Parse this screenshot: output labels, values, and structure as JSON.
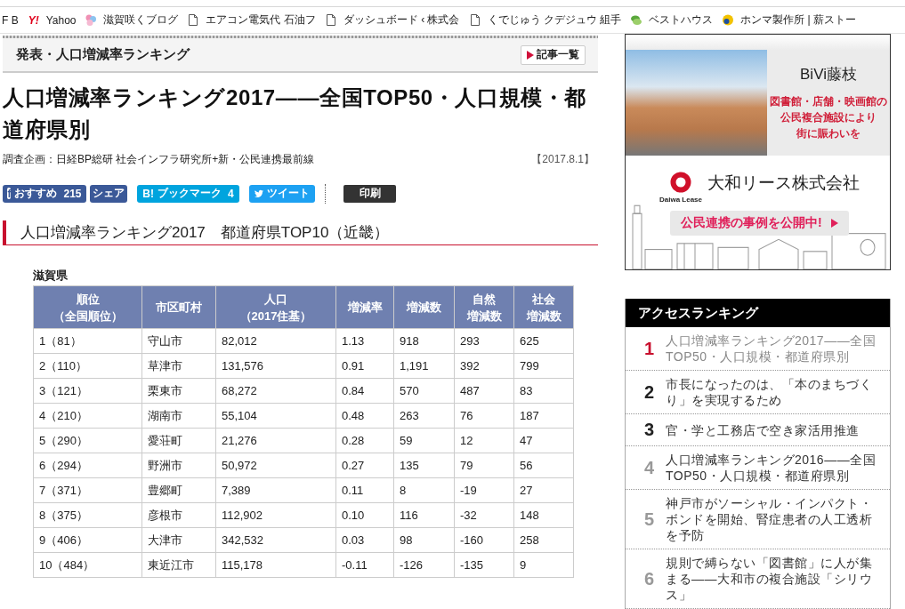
{
  "bookmarks": [
    {
      "kind": "none",
      "label": "F B"
    },
    {
      "kind": "text",
      "badge": "Y!",
      "label": "Yahoo"
    },
    {
      "kind": "flower",
      "label": "滋賀咲くブログ"
    },
    {
      "kind": "page",
      "label": "エアコン電気代 石油フ"
    },
    {
      "kind": "page",
      "label": "ダッシュボード ‹ 株式会"
    },
    {
      "kind": "page",
      "label": "くでじゅう クデジュウ 組手"
    },
    {
      "kind": "leaf",
      "label": "ベストハウス"
    },
    {
      "kind": "disc",
      "label": "ホンマ製作所 | 薪ストー"
    }
  ],
  "section_bar": {
    "title": "発表・人口増減率ランキング",
    "button": "記事一覧"
  },
  "article": {
    "title": "人口増減率ランキング2017――全国TOP50・人口規模・都道府県別",
    "byline": "調査企画：日経BP総研 社会インフラ研究所+新・公民連携最前線",
    "date": "【2017.8.1】",
    "share_buttons": [
      {
        "kind": "like",
        "badge": "f",
        "label": "おすすめ",
        "count": "215"
      },
      {
        "kind": "share",
        "label": "シェア"
      },
      {
        "kind": "bookmark",
        "badge": "B!",
        "label": "ブックマーク",
        "count": "4"
      },
      {
        "kind": "tweet",
        "label": "ツイート"
      },
      {
        "kind": "print",
        "label": "印刷"
      }
    ],
    "subheading": "人口増減率ランキング2017　都道府県TOP10（近畿）",
    "table": {
      "caption": "滋賀県",
      "columns": [
        "順位（全国順位）",
        "市区町村",
        "人口（2017住基）",
        "増減率",
        "増減数",
        "自然増減数",
        "社会増減数"
      ],
      "rows": [
        [
          "1（81）",
          "守山市",
          "82,012",
          "1.13",
          "918",
          "293",
          "625"
        ],
        [
          "2（110）",
          "草津市",
          "131,576",
          "0.91",
          "1,191",
          "392",
          "799"
        ],
        [
          "3（121）",
          "栗東市",
          "68,272",
          "0.84",
          "570",
          "487",
          "83"
        ],
        [
          "4（210）",
          "湖南市",
          "55,104",
          "0.48",
          "263",
          "76",
          "187"
        ],
        [
          "5（290）",
          "愛荘町",
          "21,276",
          "0.28",
          "59",
          "12",
          "47"
        ],
        [
          "6（294）",
          "野洲市",
          "50,972",
          "0.27",
          "135",
          "79",
          "56"
        ],
        [
          "7（371）",
          "豊郷町",
          "7,389",
          "0.11",
          "8",
          "-19",
          "27"
        ],
        [
          "8（375）",
          "彦根市",
          "112,902",
          "0.10",
          "116",
          "-32",
          "148"
        ],
        [
          "9（406）",
          "大津市",
          "342,532",
          "0.03",
          "98",
          "-160",
          "258"
        ],
        [
          "10（484）",
          "東近江市",
          "115,178",
          "-0.11",
          "-126",
          "-135",
          "9"
        ]
      ]
    }
  },
  "ad": {
    "headline": "BiVi藤枝",
    "tagline": [
      "図書館・店舗・映画館の",
      "公民複合施設により",
      "街に賑わいを"
    ],
    "logo_caption": "Daiwa Lease",
    "company": "大和リース株式会社",
    "cta": "公民連携の事例を公開中!"
  },
  "ranking": {
    "title": "アクセスランキング",
    "items": [
      {
        "rank": "1",
        "color": "#c8102e",
        "current": true,
        "title": "人口増減率ランキング2017――全国TOP50・人口規模・都道府県別"
      },
      {
        "rank": "2",
        "color": "#222222",
        "current": false,
        "title": "市長になったのは、「本のまちづくり」を実現するため"
      },
      {
        "rank": "3",
        "color": "#222222",
        "current": false,
        "title": "官・学と工務店で空き家活用推進"
      },
      {
        "rank": "4",
        "color": "#999999",
        "current": false,
        "title": "人口増減率ランキング2016――全国TOP50・人口規模・都道府県別"
      },
      {
        "rank": "5",
        "color": "#999999",
        "current": false,
        "title": "神戸市がソーシャル・インパクト・ボンドを開始、腎症患者の人工透析を予防"
      },
      {
        "rank": "6",
        "color": "#999999",
        "current": false,
        "title": "規則で縛らない「図書館」に人が集まる――大和市の複合施設「シリウス」"
      }
    ]
  }
}
